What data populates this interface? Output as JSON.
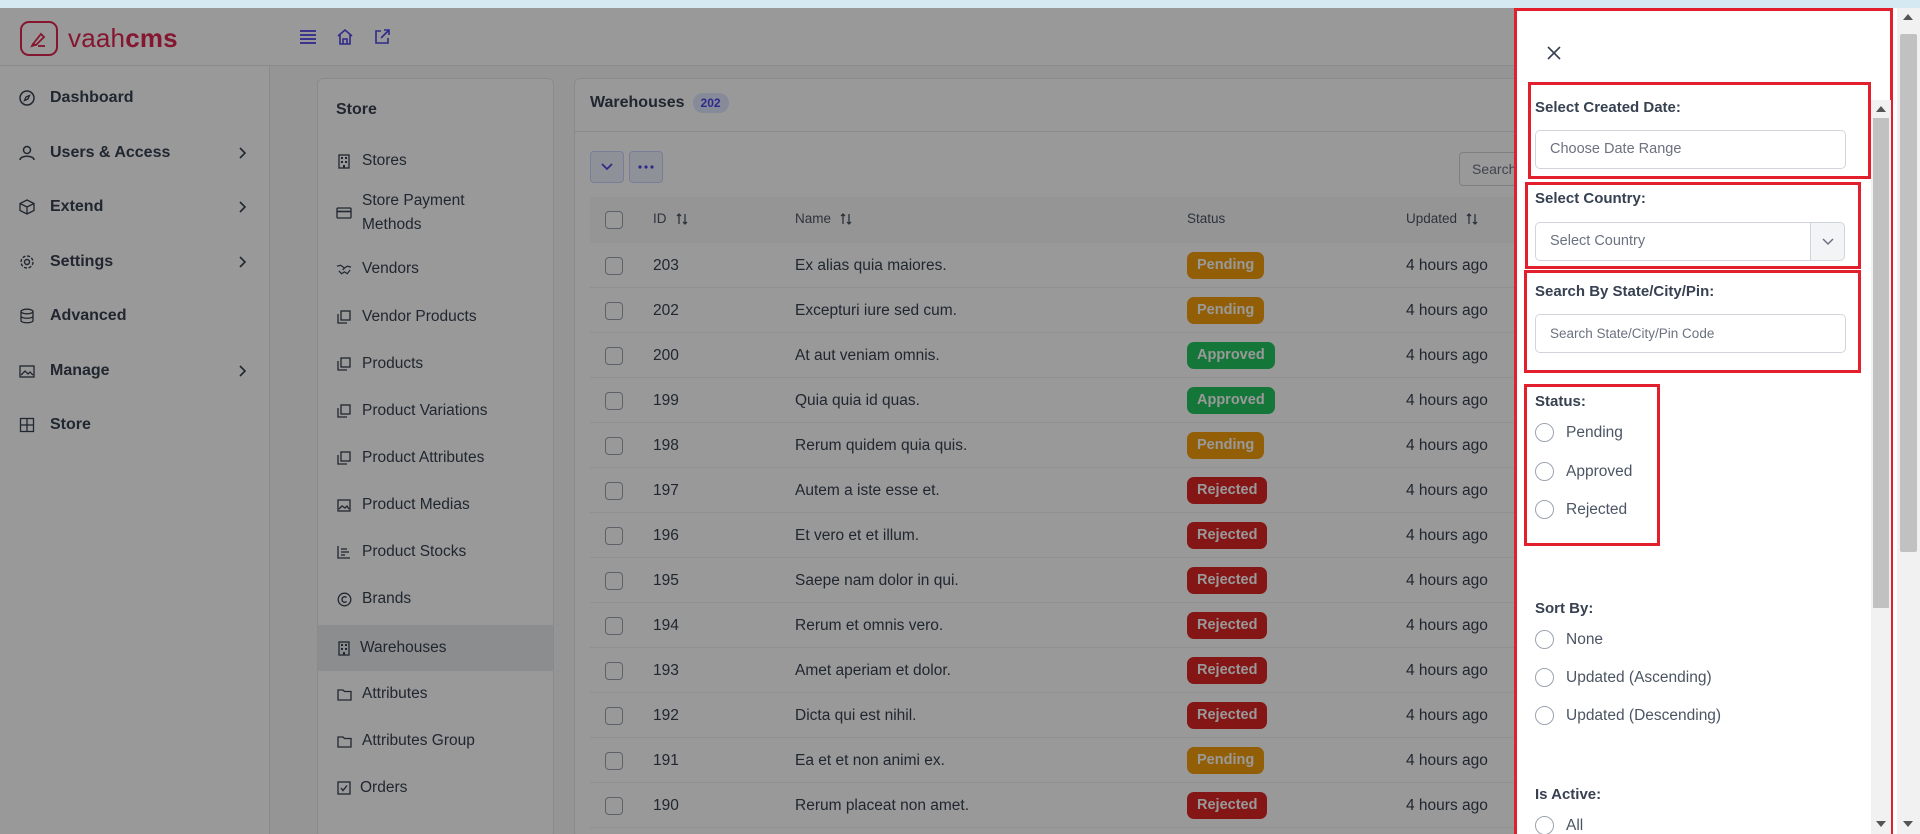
{
  "app": {
    "logo_prefix": "vaah",
    "logo_suffix": "cms",
    "brand_color": "#dc2650"
  },
  "top_icons": [
    "menu-icon",
    "home-icon",
    "external-link-icon"
  ],
  "sidebar": {
    "items": [
      {
        "label": "Dashboard",
        "icon": "compass-icon",
        "has_children": false
      },
      {
        "label": "Users & Access",
        "icon": "user-icon",
        "has_children": true
      },
      {
        "label": "Extend",
        "icon": "box-icon",
        "has_children": true
      },
      {
        "label": "Settings",
        "icon": "gear-icon",
        "has_children": true
      },
      {
        "label": "Advanced",
        "icon": "database-icon",
        "has_children": false
      },
      {
        "label": "Manage",
        "icon": "image-icon",
        "has_children": true
      },
      {
        "label": "Store",
        "icon": "grid-icon",
        "has_children": false
      }
    ]
  },
  "store_menu": {
    "title": "Store",
    "items": [
      {
        "label": "Stores",
        "icon": "building-icon"
      },
      {
        "label": "Store Payment Methods",
        "icon": "credit-card-icon"
      },
      {
        "label": "Vendors",
        "icon": "handshake-icon"
      },
      {
        "label": "Vendor Products",
        "icon": "copy-icon"
      },
      {
        "label": "Products",
        "icon": "copy-icon"
      },
      {
        "label": "Product Variations",
        "icon": "copy-icon"
      },
      {
        "label": "Product Attributes",
        "icon": "copy-icon"
      },
      {
        "label": "Product Medias",
        "icon": "image-icon"
      },
      {
        "label": "Product Stocks",
        "icon": "list-icon"
      },
      {
        "label": "Brands",
        "icon": "copyright-icon"
      },
      {
        "label": "Warehouses",
        "icon": "building-icon",
        "active": true
      },
      {
        "label": "Attributes",
        "icon": "folder-icon"
      },
      {
        "label": "Attributes Group",
        "icon": "folder-icon"
      },
      {
        "label": "Orders",
        "icon": "check-square-icon"
      }
    ]
  },
  "list": {
    "title": "Warehouses",
    "count": "202",
    "search_placeholder": "Search",
    "columns": {
      "id": "ID",
      "name": "Name",
      "status": "Status",
      "updated": "Updated"
    },
    "rows": [
      {
        "id": "203",
        "name": "Ex alias quia maiores.",
        "status": "Pending",
        "updated": "4 hours ago"
      },
      {
        "id": "202",
        "name": "Excepturi iure sed cum.",
        "status": "Pending",
        "updated": "4 hours ago"
      },
      {
        "id": "200",
        "name": "At aut veniam omnis.",
        "status": "Approved",
        "updated": "4 hours ago"
      },
      {
        "id": "199",
        "name": "Quia quia id quas.",
        "status": "Approved",
        "updated": "4 hours ago"
      },
      {
        "id": "198",
        "name": "Rerum quidem quia quis.",
        "status": "Pending",
        "updated": "4 hours ago"
      },
      {
        "id": "197",
        "name": "Autem a iste esse et.",
        "status": "Rejected",
        "updated": "4 hours ago"
      },
      {
        "id": "196",
        "name": "Et vero et et illum.",
        "status": "Rejected",
        "updated": "4 hours ago"
      },
      {
        "id": "195",
        "name": "Saepe nam dolor in qui.",
        "status": "Rejected",
        "updated": "4 hours ago"
      },
      {
        "id": "194",
        "name": "Rerum et omnis vero.",
        "status": "Rejected",
        "updated": "4 hours ago"
      },
      {
        "id": "193",
        "name": "Amet aperiam et dolor.",
        "status": "Rejected",
        "updated": "4 hours ago"
      },
      {
        "id": "192",
        "name": "Dicta qui est nihil.",
        "status": "Rejected",
        "updated": "4 hours ago"
      },
      {
        "id": "191",
        "name": "Ea et et non animi ex.",
        "status": "Pending",
        "updated": "4 hours ago"
      },
      {
        "id": "190",
        "name": "Rerum placeat non amet.",
        "status": "Rejected",
        "updated": "4 hours ago"
      }
    ]
  },
  "filters": {
    "created_date": {
      "label": "Select Created Date:",
      "placeholder": "Choose Date Range"
    },
    "country": {
      "label": "Select Country:",
      "placeholder": "Select Country"
    },
    "location": {
      "label": "Search By State/City/Pin:",
      "placeholder": "Search State/City/Pin Code"
    },
    "status": {
      "label": "Status:",
      "options": [
        "Pending",
        "Approved",
        "Rejected"
      ]
    },
    "sort_by": {
      "label": "Sort By:",
      "options": [
        "None",
        "Updated (Ascending)",
        "Updated (Descending)"
      ]
    },
    "is_active": {
      "label": "Is Active:",
      "options": [
        "All"
      ]
    }
  },
  "colors": {
    "pending": "#f59e0b",
    "approved": "#22c55e",
    "rejected": "#dc2626",
    "highlight": "#e21f2c"
  }
}
